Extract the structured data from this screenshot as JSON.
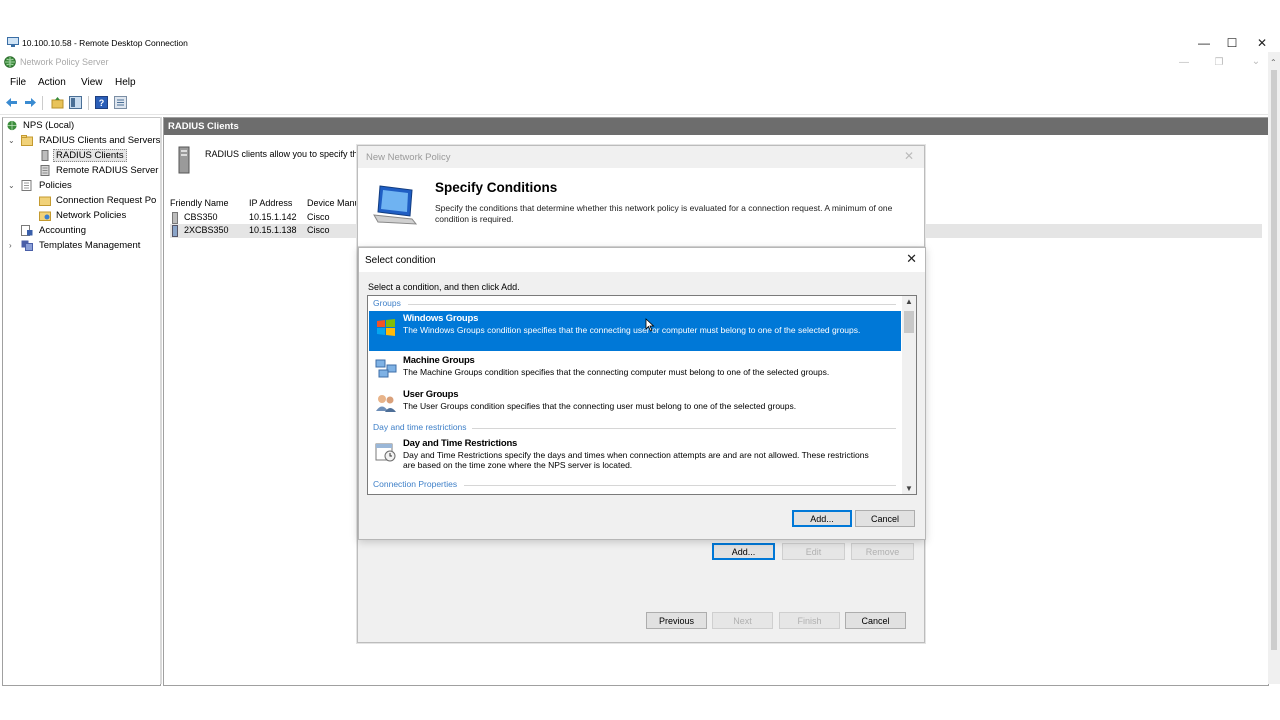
{
  "rdp": {
    "title": "10.100.10.58 - Remote Desktop Connection",
    "minimize": "—",
    "maximize": "☐",
    "close": "✕"
  },
  "app": {
    "title": "Network Policy Server",
    "menu": [
      "File",
      "Action",
      "View",
      "Help"
    ]
  },
  "tree": {
    "items": [
      {
        "label": "NPS (Local)"
      },
      {
        "label": "RADIUS Clients and Servers"
      },
      {
        "label": "RADIUS Clients"
      },
      {
        "label": "Remote RADIUS Server"
      },
      {
        "label": "Policies"
      },
      {
        "label": "Connection Request Po"
      },
      {
        "label": "Network Policies"
      },
      {
        "label": "Accounting"
      },
      {
        "label": "Templates Management"
      }
    ]
  },
  "right": {
    "header": "RADIUS Clients",
    "info": "RADIUS clients allow you to specify the",
    "columns": [
      "Friendly Name",
      "IP Address",
      "Device Manu"
    ],
    "rows": [
      {
        "name": "CBS350",
        "ip": "10.15.1.142",
        "vendor": "Cisco"
      },
      {
        "name": "2XCBS350",
        "ip": "10.15.1.138",
        "vendor": "Cisco"
      }
    ]
  },
  "nnp": {
    "title": "New Network Policy",
    "heading": "Specify Conditions",
    "description": "Specify the conditions that determine whether this network policy is evaluated for a connection request. A minimum of one condition is required.",
    "add_label": "Add...",
    "edit_label": "Edit",
    "remove_label": "Remove",
    "previous_label": "Previous",
    "next_label": "Next",
    "finish_label": "Finish",
    "cancel_label": "Cancel"
  },
  "select_condition": {
    "title": "Select condition",
    "instruction": "Select a condition, and then click Add.",
    "groups": [
      {
        "label": "Groups"
      },
      {
        "label": "Day and time restrictions"
      },
      {
        "label": "Connection Properties"
      }
    ],
    "items": [
      {
        "title": "Windows Groups",
        "desc": "The Windows Groups condition specifies that the connecting user or computer must belong to one of the selected groups.",
        "selected": true
      },
      {
        "title": "Machine Groups",
        "desc": "The Machine Groups condition specifies that the connecting computer must belong to one of the selected groups."
      },
      {
        "title": "User Groups",
        "desc": "The User Groups condition specifies that the connecting user must belong to one of the selected groups."
      },
      {
        "title": "Day and Time Restrictions",
        "desc": "Day and Time Restrictions specify the days and times when connection attempts are and are not allowed. These restrictions are based on the time zone where the NPS server is located."
      }
    ],
    "add_label": "Add...",
    "cancel_label": "Cancel"
  },
  "colors": {
    "selection": "#0078d7",
    "group_header": "#3f80c8",
    "pane_header": "#6d6d6d"
  }
}
